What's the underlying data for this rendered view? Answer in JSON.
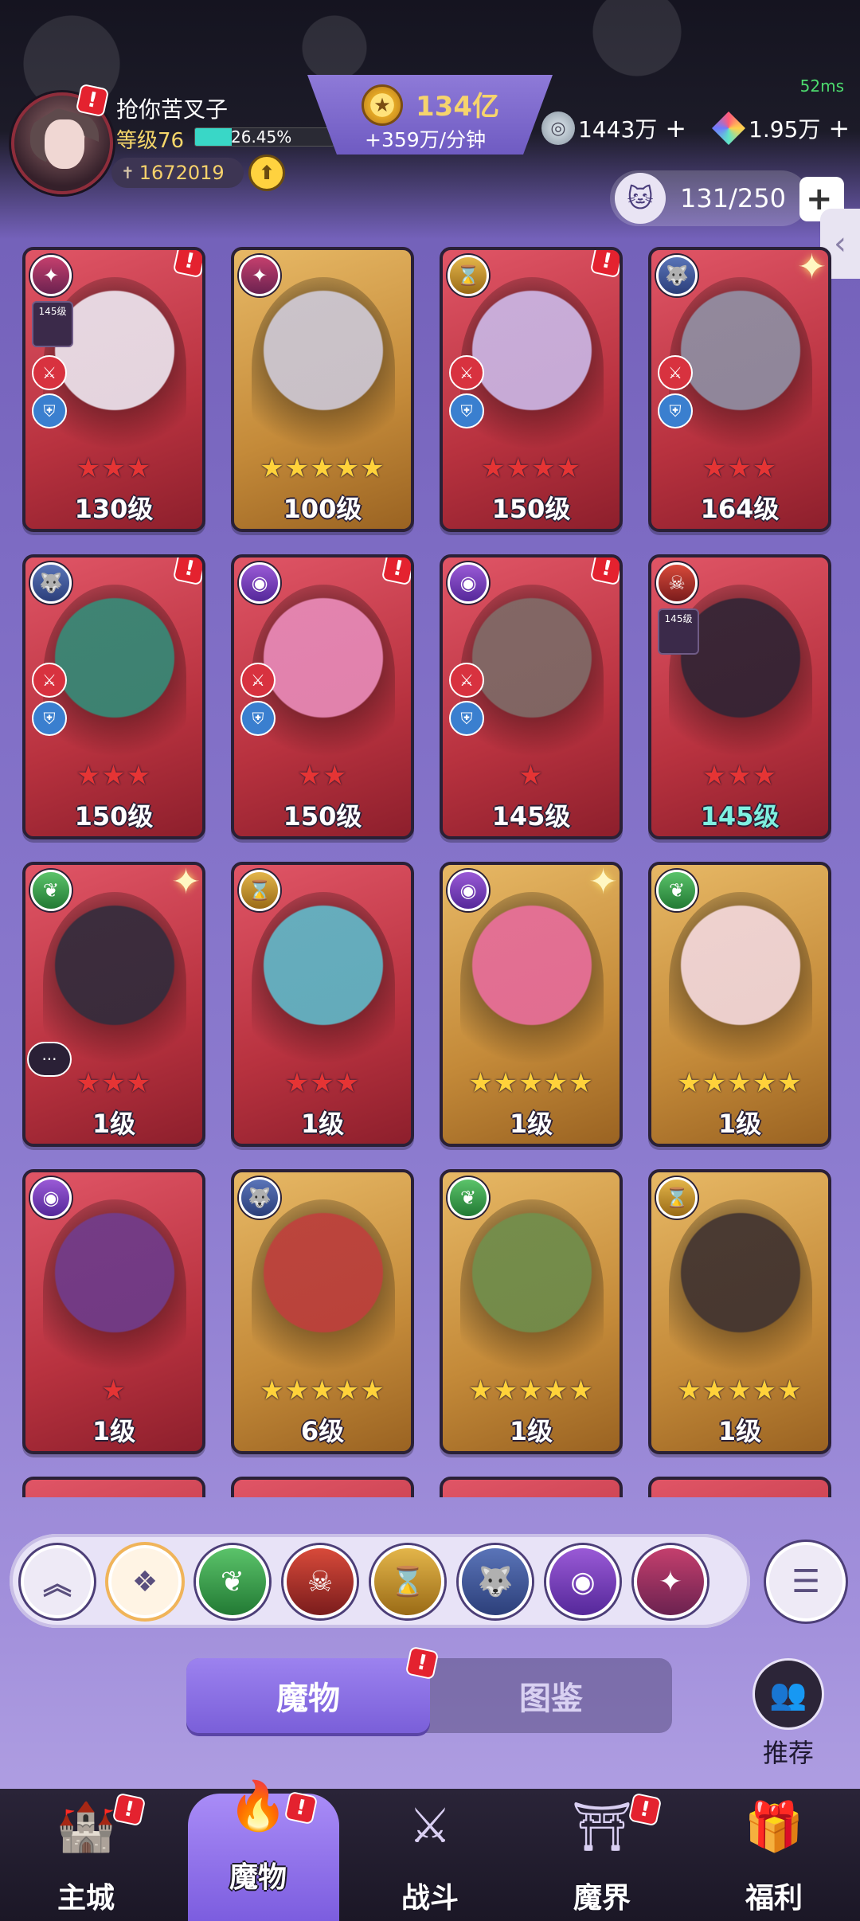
{
  "status": {
    "latency": "52ms"
  },
  "player": {
    "name": "抢你苦叉子",
    "level": "等级76",
    "xp_percent_text": "26.45%",
    "xp_fraction": 0.2645,
    "power": "1672019",
    "notice": "!"
  },
  "gold": {
    "amount": "134亿",
    "rate": "+359万/分钟",
    "icon": "coin-icon"
  },
  "resources": [
    {
      "amount": "1443万",
      "icon": "silver-coin-icon",
      "plus": "+"
    },
    {
      "amount": "1.95万",
      "icon": "prism-gem-icon",
      "plus": "+"
    }
  ],
  "inventory": {
    "capacity": "131/250",
    "icon": "cat-silhouette-icon",
    "plus": "+"
  },
  "cards": [
    {
      "level": "130级",
      "stars": "★★★",
      "frame": "red",
      "faction": "swirl",
      "notice": true
    },
    {
      "level": "100级",
      "stars": "★★★★★",
      "frame": "gold",
      "faction": "swirl",
      "notice": false
    },
    {
      "level": "150级",
      "stars": "★★★★",
      "frame": "red",
      "faction": "hourglass",
      "notice": true
    },
    {
      "level": "164级",
      "stars": "★★★",
      "frame": "red",
      "faction": "wolf",
      "notice": false
    },
    {
      "level": "150级",
      "stars": "★★★",
      "frame": "red",
      "faction": "wolf",
      "notice": true
    },
    {
      "level": "150级",
      "stars": "★★",
      "frame": "red",
      "faction": "eye",
      "notice": true
    },
    {
      "level": "145级",
      "stars": "★",
      "frame": "red",
      "faction": "eye",
      "notice": true
    },
    {
      "level": "145级",
      "stars": "★★★",
      "frame": "red",
      "faction": "skull",
      "notice": false
    },
    {
      "level": "1级",
      "stars": "★★★",
      "frame": "red",
      "faction": "leaf",
      "notice": false
    },
    {
      "level": "1级",
      "stars": "★★★",
      "frame": "red",
      "faction": "hourglass",
      "notice": false
    },
    {
      "level": "1级",
      "stars": "★★★★★",
      "frame": "gold",
      "faction": "eye",
      "notice": false
    },
    {
      "level": "1级",
      "stars": "★★★★★",
      "frame": "gold",
      "faction": "leaf",
      "notice": false
    },
    {
      "level": "1级",
      "stars": "★",
      "frame": "red",
      "faction": "eye",
      "notice": false
    },
    {
      "level": "6级",
      "stars": "★★★★★",
      "frame": "gold",
      "faction": "wolf",
      "notice": false
    },
    {
      "level": "1级",
      "stars": "★★★★★",
      "frame": "gold",
      "faction": "leaf",
      "notice": false
    },
    {
      "level": "1级",
      "stars": "★★★★★",
      "frame": "gold",
      "faction": "hourglass",
      "notice": false
    }
  ],
  "mini_badge": {
    "level": "145级"
  },
  "filters": [
    {
      "name": "collapse",
      "icon": "double-chevron-up-icon"
    },
    {
      "name": "all",
      "icon": "diamond-grid-icon"
    },
    {
      "name": "leaf",
      "icon": "leaf-faction-icon"
    },
    {
      "name": "skull",
      "icon": "skull-faction-icon"
    },
    {
      "name": "hourglass",
      "icon": "hourglass-faction-icon"
    },
    {
      "name": "wolf",
      "icon": "wolf-faction-icon"
    },
    {
      "name": "eye",
      "icon": "eye-faction-icon"
    },
    {
      "name": "swirl",
      "icon": "swirl-faction-icon"
    }
  ],
  "sort_icon": "sort-list-icon",
  "tabs": {
    "active": "魔物",
    "inactive": "图鉴"
  },
  "recommend": {
    "label": "推荐"
  },
  "nav": [
    {
      "label": "主城",
      "icon": "castle-icon",
      "notice": true
    },
    {
      "label": "魔物",
      "icon": "purple-flame-icon",
      "notice": true
    },
    {
      "label": "战斗",
      "icon": "sword-shield-icon",
      "notice": false
    },
    {
      "label": "魔界",
      "icon": "portal-icon",
      "notice": true
    },
    {
      "label": "福利",
      "icon": "treasure-chest-icon",
      "notice": false
    }
  ]
}
